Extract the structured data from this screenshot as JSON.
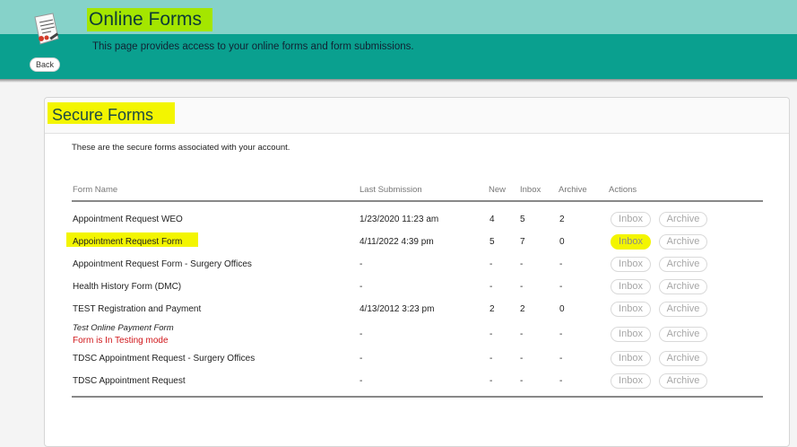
{
  "header": {
    "title": "Online Forms",
    "subtitle": "This page provides access to your online forms and form submissions.",
    "back_label": "Back"
  },
  "card": {
    "title": "Secure Forms",
    "description": "These are the secure forms associated with your account."
  },
  "table": {
    "columns": {
      "name": "Form Name",
      "last": "Last Submission",
      "new": "New",
      "inbox": "Inbox",
      "archive": "Archive",
      "actions": "Actions"
    },
    "rows": [
      {
        "name": "Appointment Request WEO",
        "last": "1/23/2020 11:23 am",
        "new": "4",
        "inbox": "5",
        "archive": "2",
        "inbox_btn": "Inbox",
        "archive_btn": "Archive"
      },
      {
        "name": "Appointment Request Form",
        "last": "4/11/2022 4:39 pm",
        "new": "5",
        "inbox": "7",
        "archive": "0",
        "inbox_btn": "Inbox",
        "archive_btn": "Archive"
      },
      {
        "name": "Appointment Request Form - Surgery Offices",
        "last": "-",
        "new": "-",
        "inbox": "-",
        "archive": "-",
        "inbox_btn": "Inbox",
        "archive_btn": "Archive"
      },
      {
        "name": "Health History Form (DMC)",
        "last": "-",
        "new": "-",
        "inbox": "-",
        "archive": "-",
        "inbox_btn": "Inbox",
        "archive_btn": "Archive"
      },
      {
        "name": "TEST Registration and Payment",
        "last": "4/13/2012 3:23 pm",
        "new": "2",
        "inbox": "2",
        "archive": "0",
        "inbox_btn": "Inbox",
        "archive_btn": "Archive"
      },
      {
        "name": "Test Online Payment Form",
        "status": "Form is In Testing mode",
        "last": "-",
        "new": "-",
        "inbox": "-",
        "archive": "-",
        "inbox_btn": "Inbox",
        "archive_btn": "Archive"
      },
      {
        "name": "TDSC Appointment Request - Surgery Offices",
        "last": "-",
        "new": "-",
        "inbox": "-",
        "archive": "-",
        "inbox_btn": "Inbox",
        "archive_btn": "Archive"
      },
      {
        "name": "TDSC Appointment Request",
        "last": "-",
        "new": "-",
        "inbox": "-",
        "archive": "-",
        "inbox_btn": "Inbox",
        "archive_btn": "Archive"
      }
    ]
  },
  "colors": {
    "header_light": "#86d2c9",
    "header_dark": "#0aa08f",
    "highlight_yellow": "#f3f500",
    "highlight_green": "#a4e600",
    "testing_red": "#d0161a"
  }
}
